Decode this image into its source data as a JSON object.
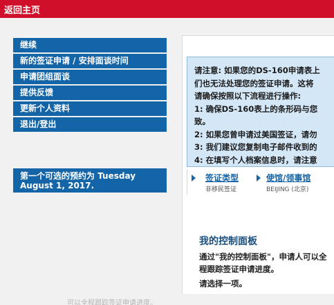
{
  "topbar": {
    "home_label": "返回主页"
  },
  "left_menu": [
    {
      "label": "继续"
    },
    {
      "label": "新的签证申请 / 安排面谈时间"
    },
    {
      "label": "申请团组面谈"
    },
    {
      "label": "提供反馈"
    },
    {
      "label": "更新个人资料"
    },
    {
      "label": "退出/登出"
    }
  ],
  "appointment": {
    "line1": "第一个可选的预约为 Tuesday",
    "line2": "August 1, 2017."
  },
  "notice": {
    "lines": [
      "请注意: 如果您的DS-160申请表上",
      "们也无法处理您的签证申请。这将",
      "请确保按照以下流程进行操作:",
      "1: 确保DS-160表上的条形码与您",
      "致。",
      "2: 如果您曾申请过美国签证，请勿",
      "3: 我们建议您复制电子邮件收到的",
      "4: 在填写个人档案信息时，请注意"
    ]
  },
  "breadcrumbs": [
    {
      "title": "签证类型",
      "subtitle": "非移民签证"
    },
    {
      "title": "使馆/领事馆",
      "subtitle": "BEIJING (北京)"
    }
  ],
  "dashboard": {
    "title": "我的控制面板",
    "description": "通过\"我的控制面板\"，申请人可以全程跟踪签证申请进度。",
    "choose": "请选择一项。",
    "faded_repeat": "可以全程跟踪签证申请进度。"
  },
  "colors": {
    "topbar": "#d0102a",
    "menu_blue": "#1464a8",
    "notice_bg": "#d3e7f7"
  }
}
